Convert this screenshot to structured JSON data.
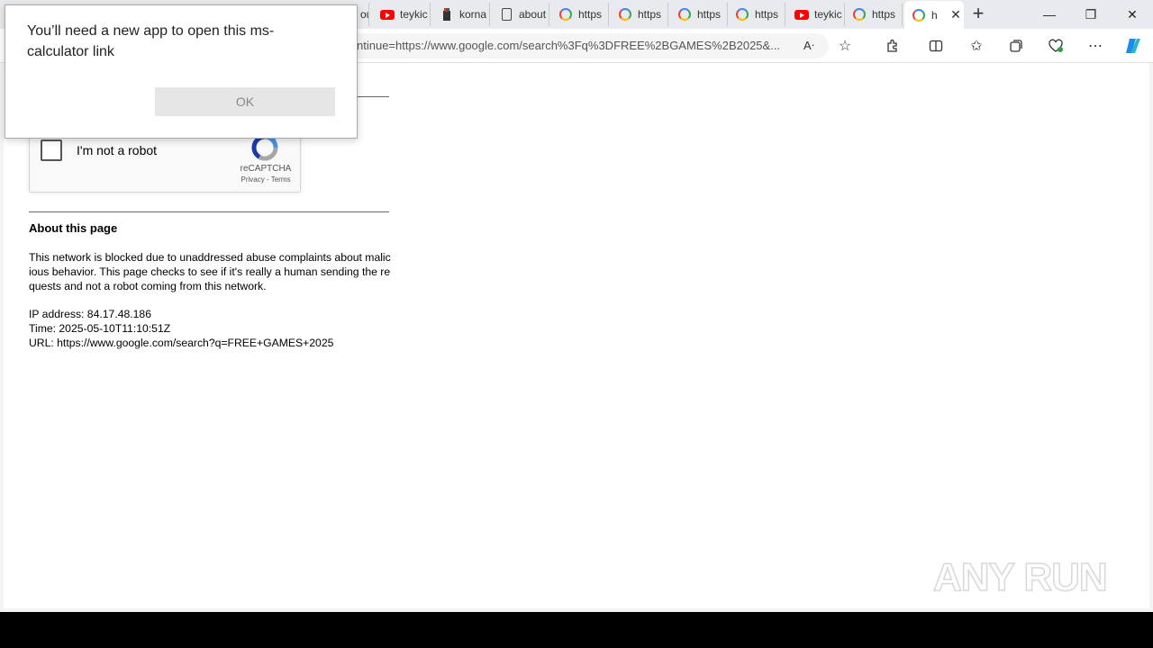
{
  "dialog": {
    "message": "You’ll need a new app to open this ms-calculator link",
    "ok_label": "OK"
  },
  "tabs": [
    {
      "label": "ou",
      "icon": "blank"
    },
    {
      "label": "teykic",
      "icon": "youtube-icon"
    },
    {
      "label": "korna",
      "icon": "app-icon"
    },
    {
      "label": "about",
      "icon": "document-icon"
    },
    {
      "label": "https",
      "icon": "google-icon"
    },
    {
      "label": "https",
      "icon": "google-icon"
    },
    {
      "label": "https",
      "icon": "google-icon"
    },
    {
      "label": "https",
      "icon": "google-icon"
    },
    {
      "label": "teykic",
      "icon": "youtube-icon"
    },
    {
      "label": "https",
      "icon": "google-icon"
    },
    {
      "label": "h",
      "icon": "google-icon",
      "active": true
    }
  ],
  "address_bar": {
    "url": "ntinue=https://www.google.com/search%3Fq%3DFREE%2BGAMES%2B2025&..."
  },
  "captcha": {
    "label": "I'm not a robot",
    "brand": "reCAPTCHA",
    "links": "Privacy - Terms"
  },
  "about": {
    "title": "About this page",
    "text": "This network is blocked due to unaddressed abuse complaints about malicious behavior. This page checks to see if it's really a human sending the requests and not a robot coming from this network.",
    "ip": "IP address: 84.17.48.186",
    "time": "Time: 2025-05-10T11:10:51Z",
    "url": "URL: https://www.google.com/search?q=FREE+GAMES+2025"
  },
  "watermark": "ANY RUN",
  "colors": {
    "taskbar": "#000000",
    "tabstrip": "#e9eaed",
    "recaptcha_blue": "#1c3aa9",
    "recaptcha_lightblue": "#4a90e2",
    "recaptcha_gray": "#a6a6a6"
  }
}
